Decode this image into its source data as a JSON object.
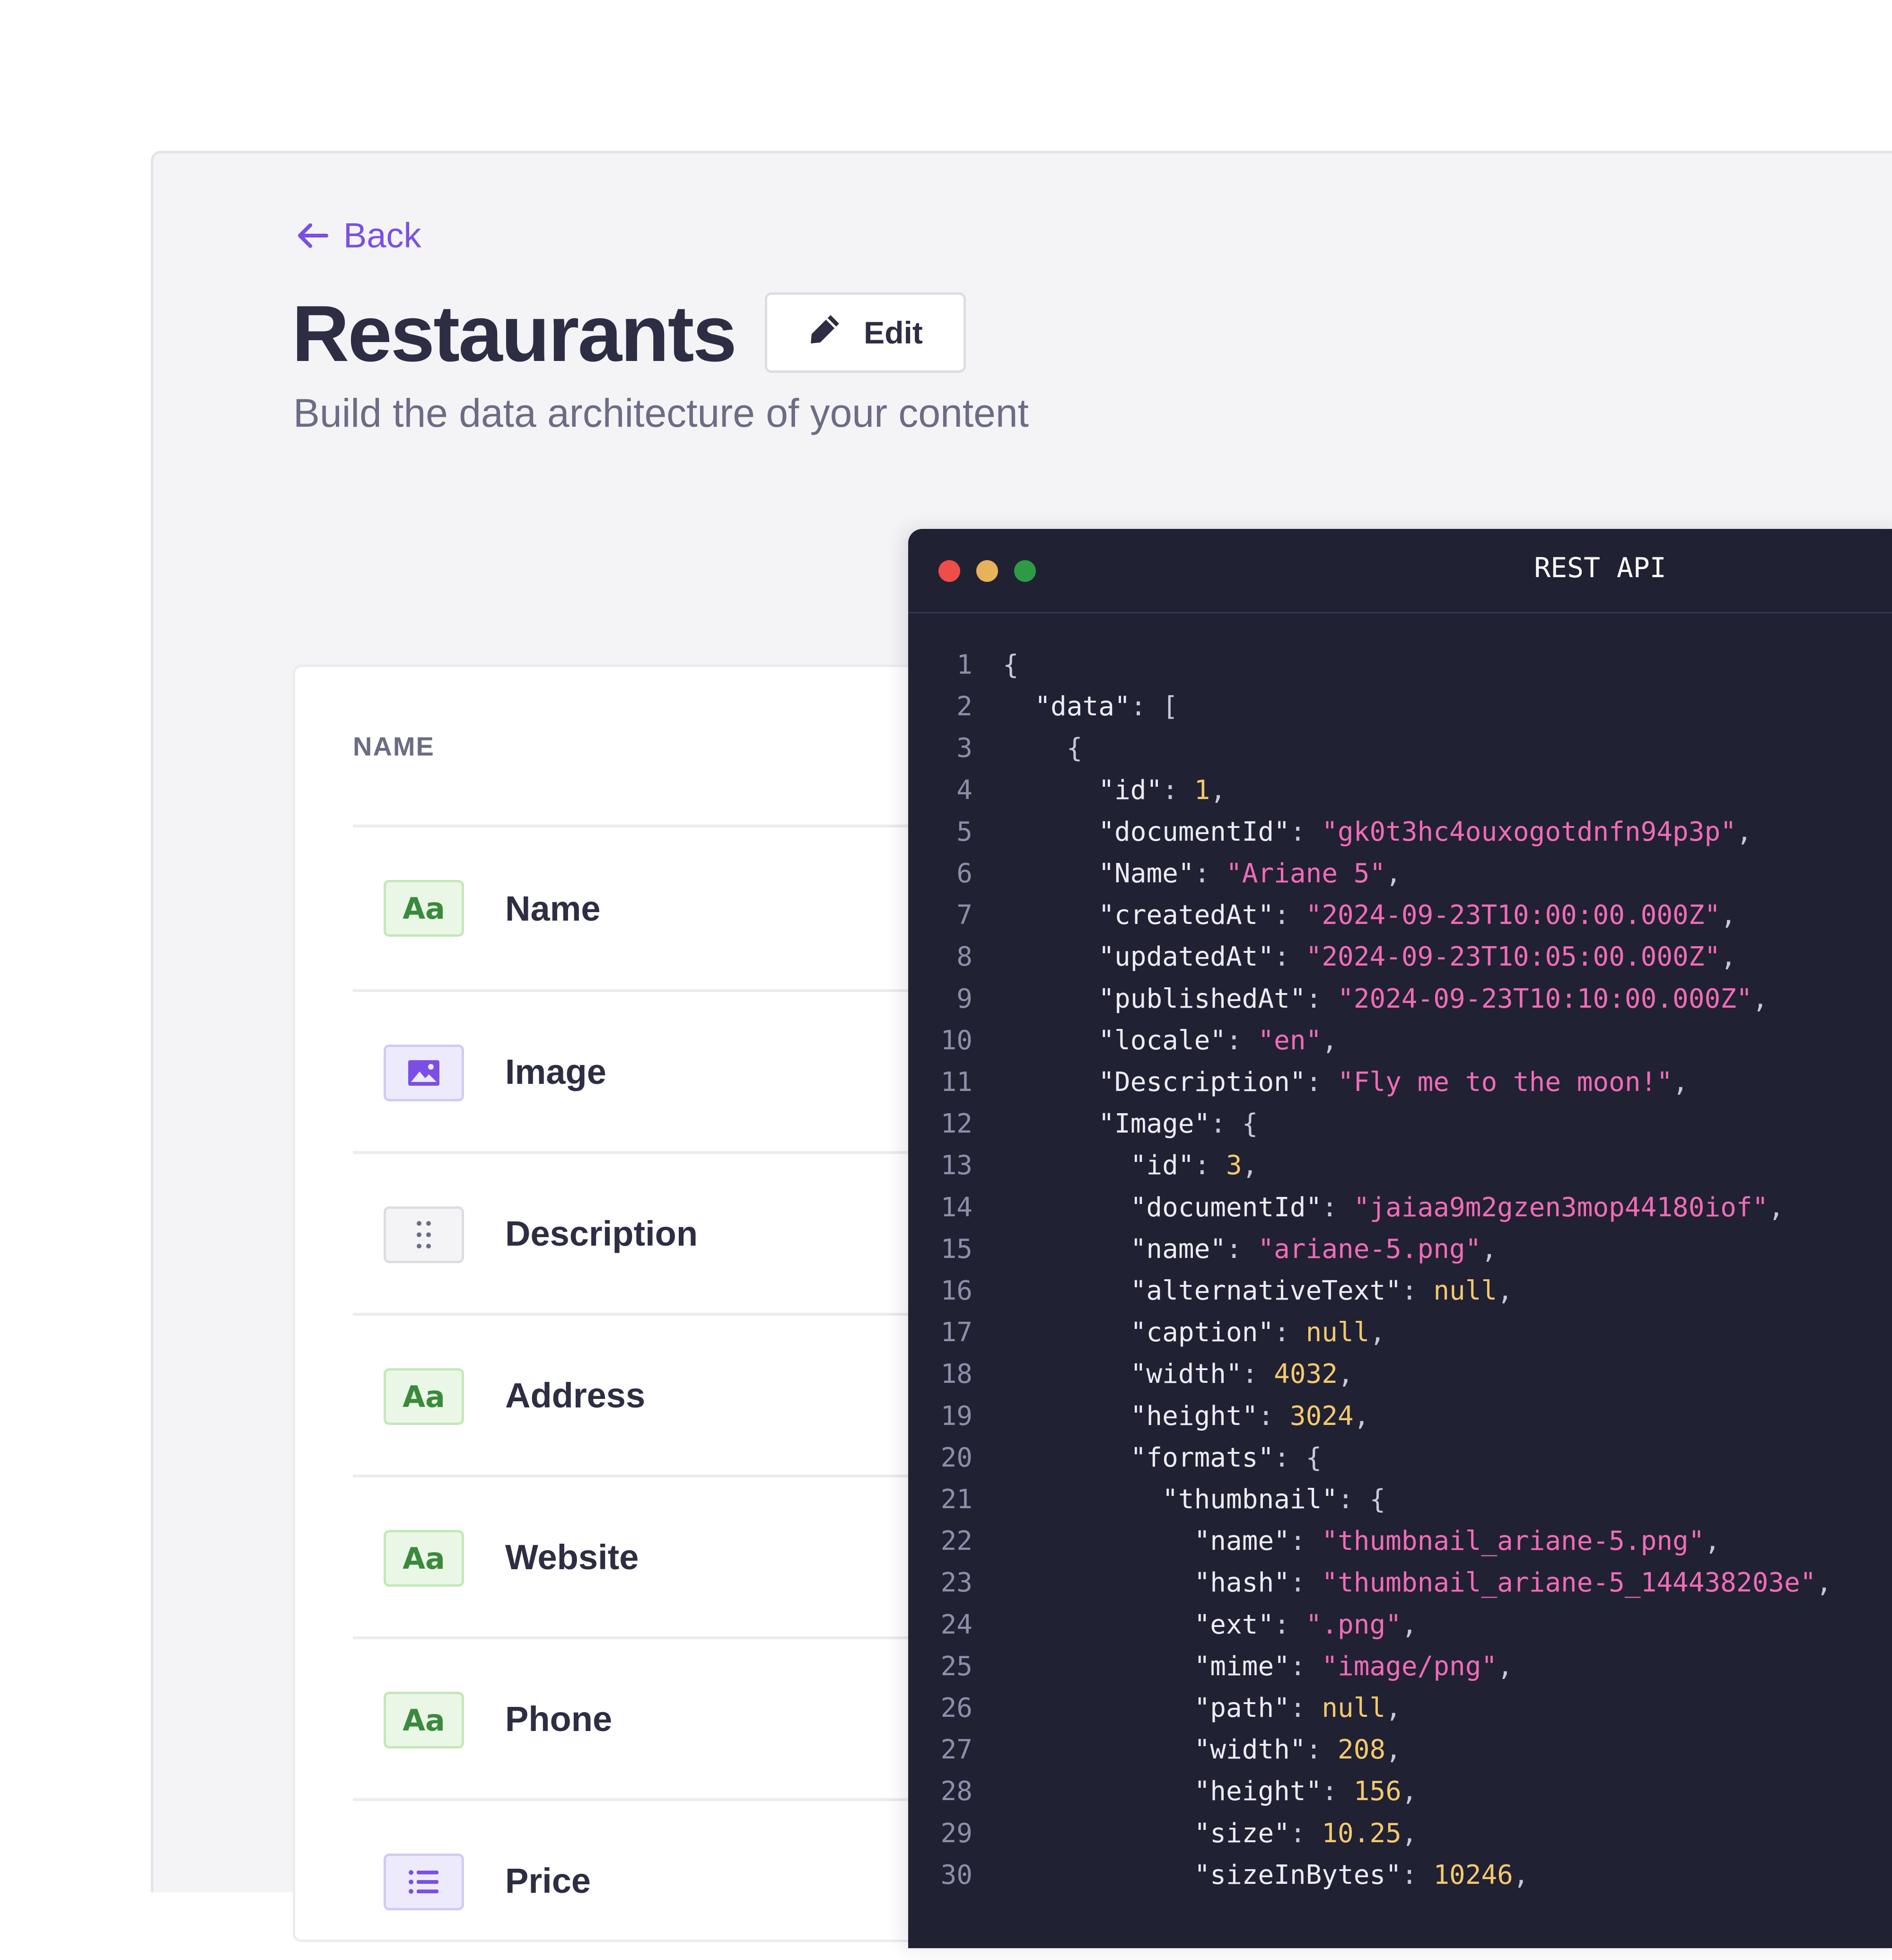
{
  "back": {
    "label": "Back"
  },
  "header": {
    "title": "Restaurants",
    "edit_label": "Edit",
    "subtitle": "Build the data architecture of your content"
  },
  "table": {
    "column_header": "NAME",
    "rows": [
      {
        "label": "Name",
        "icon": "text-icon",
        "icon_text": "Aa"
      },
      {
        "label": "Image",
        "icon": "media-icon"
      },
      {
        "label": "Description",
        "icon": "drag-dots-icon"
      },
      {
        "label": "Address",
        "icon": "text-icon",
        "icon_text": "Aa"
      },
      {
        "label": "Website",
        "icon": "text-icon",
        "icon_text": "Aa"
      },
      {
        "label": "Phone",
        "icon": "text-icon",
        "icon_text": "Aa"
      },
      {
        "label": "Price",
        "icon": "list-icon"
      }
    ]
  },
  "code_window": {
    "title": "REST API",
    "lines": [
      {
        "n": "1",
        "i": 0,
        "t": [
          [
            "p",
            "{"
          ]
        ]
      },
      {
        "n": "2",
        "i": 1,
        "t": [
          [
            "k",
            "\"data\""
          ],
          [
            "p",
            ": ["
          ]
        ]
      },
      {
        "n": "3",
        "i": 2,
        "t": [
          [
            "p",
            "{"
          ]
        ]
      },
      {
        "n": "4",
        "i": 3,
        "t": [
          [
            "k",
            "\"id\""
          ],
          [
            "p",
            ": "
          ],
          [
            "n",
            "1"
          ],
          [
            "p",
            ","
          ]
        ]
      },
      {
        "n": "5",
        "i": 3,
        "t": [
          [
            "k",
            "\"documentId\""
          ],
          [
            "p",
            ": "
          ],
          [
            "s",
            "\"gk0t3hc4ouxogotdnfn94p3p\""
          ],
          [
            "p",
            ","
          ]
        ]
      },
      {
        "n": "6",
        "i": 3,
        "t": [
          [
            "k",
            "\"Name\""
          ],
          [
            "p",
            ": "
          ],
          [
            "s",
            "\"Ariane 5\""
          ],
          [
            "p",
            ","
          ]
        ]
      },
      {
        "n": "7",
        "i": 3,
        "t": [
          [
            "k",
            "\"createdAt\""
          ],
          [
            "p",
            ": "
          ],
          [
            "s",
            "\"2024-09-23T10:00:00.000Z\""
          ],
          [
            "p",
            ","
          ]
        ]
      },
      {
        "n": "8",
        "i": 3,
        "t": [
          [
            "k",
            "\"updatedAt\""
          ],
          [
            "p",
            ": "
          ],
          [
            "s",
            "\"2024-09-23T10:05:00.000Z\""
          ],
          [
            "p",
            ","
          ]
        ]
      },
      {
        "n": "9",
        "i": 3,
        "t": [
          [
            "k",
            "\"publishedAt\""
          ],
          [
            "p",
            ": "
          ],
          [
            "s",
            "\"2024-09-23T10:10:00.000Z\""
          ],
          [
            "p",
            ","
          ]
        ]
      },
      {
        "n": "10",
        "i": 3,
        "t": [
          [
            "k",
            "\"locale\""
          ],
          [
            "p",
            ": "
          ],
          [
            "s",
            "\"en\""
          ],
          [
            "p",
            ","
          ]
        ]
      },
      {
        "n": "11",
        "i": 3,
        "t": [
          [
            "k",
            "\"Description\""
          ],
          [
            "p",
            ": "
          ],
          [
            "s",
            "\"Fly me to the moon!\""
          ],
          [
            "p",
            ","
          ]
        ]
      },
      {
        "n": "12",
        "i": 3,
        "t": [
          [
            "k",
            "\"Image\""
          ],
          [
            "p",
            ": {"
          ]
        ]
      },
      {
        "n": "13",
        "i": 4,
        "t": [
          [
            "k",
            "\"id\""
          ],
          [
            "p",
            ": "
          ],
          [
            "n",
            "3"
          ],
          [
            "p",
            ","
          ]
        ]
      },
      {
        "n": "14",
        "i": 4,
        "t": [
          [
            "k",
            "\"documentId\""
          ],
          [
            "p",
            ": "
          ],
          [
            "s",
            "\"jaiaa9m2gzen3mop44180iof\""
          ],
          [
            "p",
            ","
          ]
        ]
      },
      {
        "n": "15",
        "i": 4,
        "t": [
          [
            "k",
            "\"name\""
          ],
          [
            "p",
            ": "
          ],
          [
            "s",
            "\"ariane-5.png\""
          ],
          [
            "p",
            ","
          ]
        ]
      },
      {
        "n": "16",
        "i": 4,
        "t": [
          [
            "k",
            "\"alternativeText\""
          ],
          [
            "p",
            ": "
          ],
          [
            "n",
            "null"
          ],
          [
            "p",
            ","
          ]
        ]
      },
      {
        "n": "17",
        "i": 4,
        "t": [
          [
            "k",
            "\"caption\""
          ],
          [
            "p",
            ": "
          ],
          [
            "n",
            "null"
          ],
          [
            "p",
            ","
          ]
        ]
      },
      {
        "n": "18",
        "i": 4,
        "t": [
          [
            "k",
            "\"width\""
          ],
          [
            "p",
            ": "
          ],
          [
            "n",
            "4032"
          ],
          [
            "p",
            ","
          ]
        ]
      },
      {
        "n": "19",
        "i": 4,
        "t": [
          [
            "k",
            "\"height\""
          ],
          [
            "p",
            ": "
          ],
          [
            "n",
            "3024"
          ],
          [
            "p",
            ","
          ]
        ]
      },
      {
        "n": "20",
        "i": 4,
        "t": [
          [
            "k",
            "\"formats\""
          ],
          [
            "p",
            ": {"
          ]
        ]
      },
      {
        "n": "21",
        "i": 5,
        "t": [
          [
            "k",
            "\"thumbnail\""
          ],
          [
            "p",
            ": {"
          ]
        ]
      },
      {
        "n": "22",
        "i": 6,
        "t": [
          [
            "k",
            "\"name\""
          ],
          [
            "p",
            ": "
          ],
          [
            "s",
            "\"thumbnail_ariane-5.png\""
          ],
          [
            "p",
            ","
          ]
        ]
      },
      {
        "n": "23",
        "i": 6,
        "t": [
          [
            "k",
            "\"hash\""
          ],
          [
            "p",
            ": "
          ],
          [
            "s",
            "\"thumbnail_ariane-5_144438203e\""
          ],
          [
            "p",
            ","
          ]
        ]
      },
      {
        "n": "24",
        "i": 6,
        "t": [
          [
            "k",
            "\"ext\""
          ],
          [
            "p",
            ": "
          ],
          [
            "s",
            "\".png\""
          ],
          [
            "p",
            ","
          ]
        ]
      },
      {
        "n": "25",
        "i": 6,
        "t": [
          [
            "k",
            "\"mime\""
          ],
          [
            "p",
            ": "
          ],
          [
            "s",
            "\"image/png\""
          ],
          [
            "p",
            ","
          ]
        ]
      },
      {
        "n": "26",
        "i": 6,
        "t": [
          [
            "k",
            "\"path\""
          ],
          [
            "p",
            ": "
          ],
          [
            "n",
            "null"
          ],
          [
            "p",
            ","
          ]
        ]
      },
      {
        "n": "27",
        "i": 6,
        "t": [
          [
            "k",
            "\"width\""
          ],
          [
            "p",
            ": "
          ],
          [
            "n",
            "208"
          ],
          [
            "p",
            ","
          ]
        ]
      },
      {
        "n": "28",
        "i": 6,
        "t": [
          [
            "k",
            "\"height\""
          ],
          [
            "p",
            ": "
          ],
          [
            "n",
            "156"
          ],
          [
            "p",
            ","
          ]
        ]
      },
      {
        "n": "29",
        "i": 6,
        "t": [
          [
            "k",
            "\"size\""
          ],
          [
            "p",
            ": "
          ],
          [
            "n",
            "10.25"
          ],
          [
            "p",
            ","
          ]
        ]
      },
      {
        "n": "30",
        "i": 6,
        "t": [
          [
            "k",
            "\"sizeInBytes\""
          ],
          [
            "p",
            ": "
          ],
          [
            "n",
            "10246"
          ],
          [
            "p",
            ","
          ]
        ]
      }
    ]
  },
  "colors": {
    "accent": "#7b4fe6",
    "heading": "#2d2d44",
    "code_bg": "#212134",
    "code_string": "#f06cb7",
    "code_number": "#f2c96d"
  }
}
